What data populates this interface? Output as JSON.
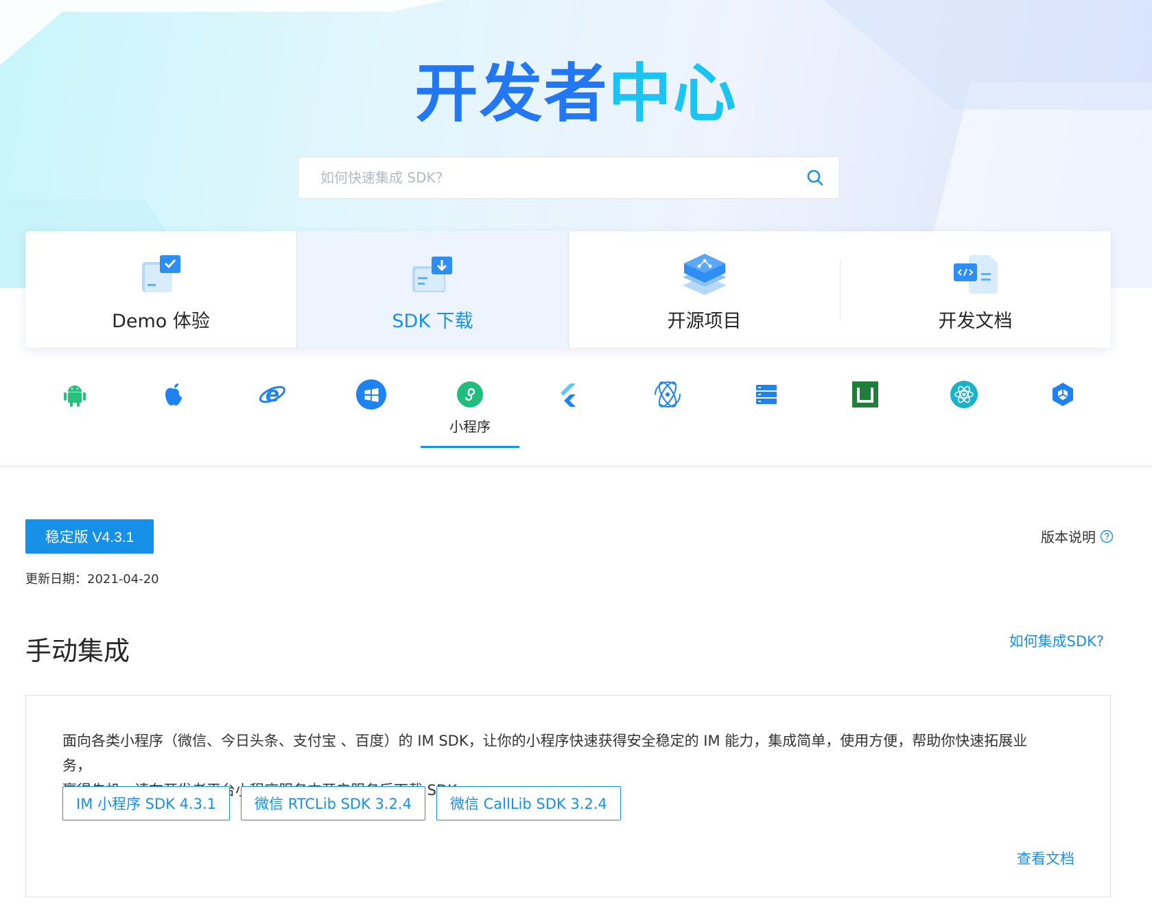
{
  "hero": {
    "title_part1": "开发者",
    "title_part2": "中心",
    "search_placeholder": "如何快速集成 SDK?"
  },
  "categories": [
    {
      "label": "Demo 体验",
      "icon": "demo-icon",
      "active": false
    },
    {
      "label": "SDK 下载",
      "icon": "sdk-download-icon",
      "active": true
    },
    {
      "label": "开源项目",
      "icon": "open-source-icon",
      "active": false
    },
    {
      "label": "开发文档",
      "icon": "docs-icon",
      "active": false
    }
  ],
  "platforms": [
    {
      "icon": "android-icon",
      "label": ""
    },
    {
      "icon": "apple-icon",
      "label": ""
    },
    {
      "icon": "ie-web-icon",
      "label": ""
    },
    {
      "icon": "windows-icon",
      "label": ""
    },
    {
      "icon": "miniprogram-icon",
      "label": "小程序",
      "active": true
    },
    {
      "icon": "flutter-icon",
      "label": ""
    },
    {
      "icon": "electron-icon",
      "label": ""
    },
    {
      "icon": "server-icon",
      "label": ""
    },
    {
      "icon": "uniapp-icon",
      "label": ""
    },
    {
      "icon": "react-native-icon",
      "label": ""
    },
    {
      "icon": "unity-icon",
      "label": ""
    }
  ],
  "version": {
    "button_label": "稳定版 V4.3.1",
    "note_label": "版本说明",
    "update_label": "更新日期：",
    "update_date": "2021-04-20"
  },
  "section": {
    "title": "手动集成",
    "howto_link": "如何集成SDK?",
    "description_line1": "面向各类小程序（微信、今日头条、支付宝 、百度）的 IM SDK，让你的小程序快速获得安全稳定的 IM 能力，集成简单，使用方便，帮助你快速拓展业务，",
    "description_line2": "赢得先机，请在开发者平台小程序服务中开启服务后下载 SDK。",
    "downloads": [
      "IM 小程序 SDK 4.3.1",
      "微信 RTCLib SDK 3.2.4",
      "微信 CallLib SDK 3.2.4"
    ],
    "doc_link": "查看文档"
  },
  "colors": {
    "accent": "#1790e8",
    "title_blue": "#2378f2",
    "title_cyan": "#1cc4f2"
  }
}
